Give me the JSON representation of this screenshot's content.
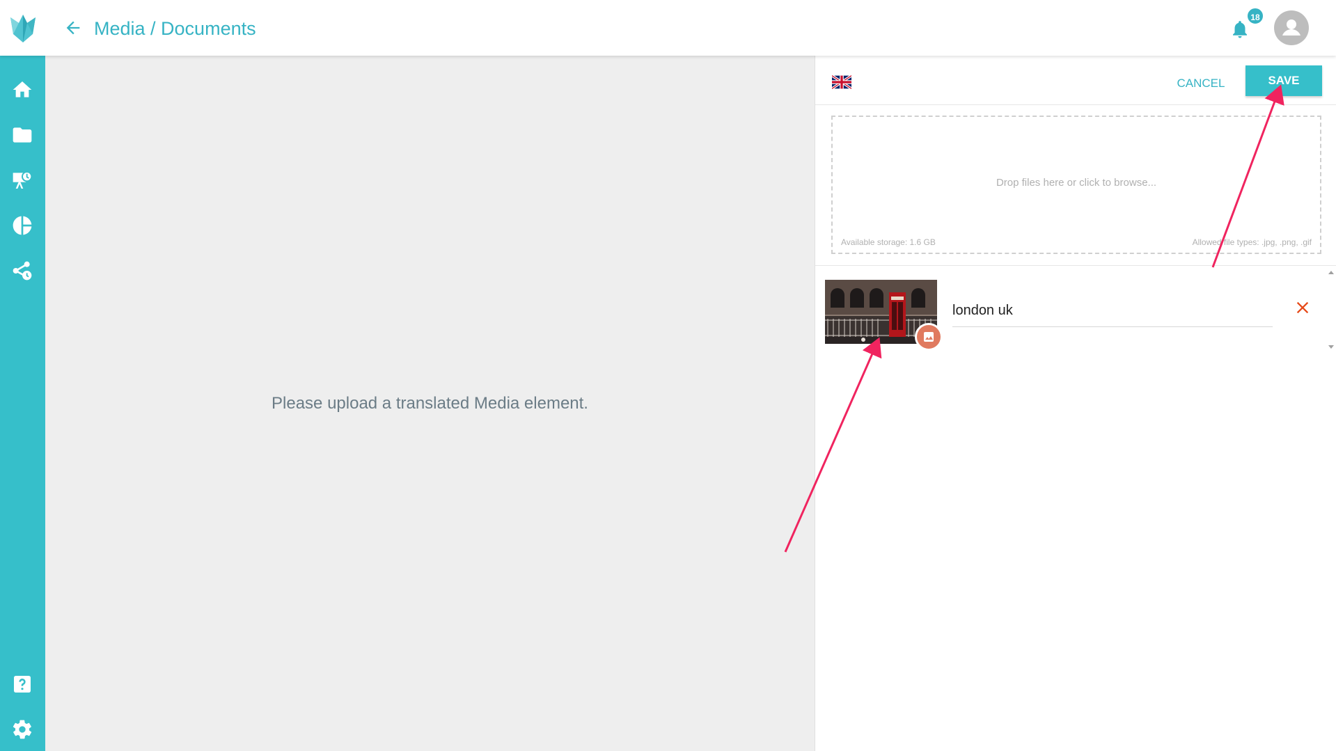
{
  "header": {
    "breadcrumb": "Media / Documents",
    "notification_count": "18"
  },
  "icons": {
    "logo": "fox-logo-icon",
    "back": "arrow-left-icon",
    "bell": "bell-icon",
    "avatar": "user-avatar-icon"
  },
  "sidebar": {
    "items": [
      {
        "name": "home",
        "icon": "home-icon"
      },
      {
        "name": "media",
        "icon": "folder-icon"
      },
      {
        "name": "presentations",
        "icon": "presentation-clock-icon"
      },
      {
        "name": "analytics",
        "icon": "pie-chart-icon"
      },
      {
        "name": "share",
        "icon": "share-clock-icon"
      }
    ],
    "bottom": [
      {
        "name": "help",
        "icon": "help-icon"
      },
      {
        "name": "settings",
        "icon": "gear-icon"
      }
    ]
  },
  "main": {
    "message": "Please upload a translated Media element."
  },
  "panel": {
    "language_flag": "uk-flag-icon",
    "cancel_label": "CANCEL",
    "save_label": "SAVE",
    "dropzone": {
      "text": "Drop files here or click to browse...",
      "storage": "Available storage: 1.6 GB",
      "types": "Allowed file types: .jpg, .png, .gif"
    },
    "files": [
      {
        "name": "london uk",
        "thumbnail": "london-phone-box-photo"
      }
    ]
  },
  "colors": {
    "accent": "#36bfca",
    "text_accent": "#36b3c4",
    "remove": "#e64a19",
    "image_badge": "#e07a5f",
    "annotation_arrow": "#f0245f"
  }
}
